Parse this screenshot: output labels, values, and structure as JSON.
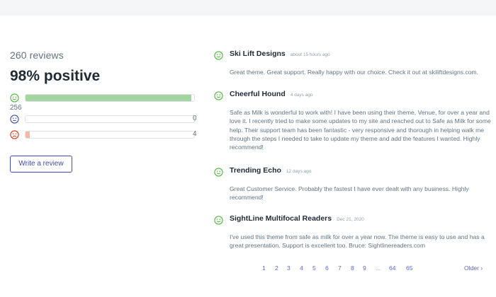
{
  "colors": {
    "positive": "#50b83c",
    "neutral": "#3f4eae",
    "negative": "#de3618",
    "positive_bar": "#a5d6a1",
    "negative_bar": "#f2b8a8",
    "link": "#5c6ac4"
  },
  "summary": {
    "reviews_count": "260 reviews",
    "positive_percent": "98% positive",
    "bars": [
      {
        "sentiment": "positive",
        "icon": "smile-icon",
        "count": "256",
        "fraction": 0.985
      },
      {
        "sentiment": "neutral",
        "icon": "neutral-face-icon",
        "count": "0",
        "fraction": 0.0
      },
      {
        "sentiment": "negative",
        "icon": "frown-icon",
        "count": "4",
        "fraction": 0.015
      }
    ],
    "write_review_label": "Write a review"
  },
  "reviews": [
    {
      "name": "Ski Lift Designs",
      "time": "about 15 hours ago",
      "body": "Great theme. Great support. Really happy with our choice. Check it out at skiliftdesigns.com.",
      "sentiment": "positive"
    },
    {
      "name": "Cheerful Hound",
      "time": "4 days ago",
      "body": "Safe as Milk is wonderful to work with! I have been using their theme, Venue, for over a year and love it. I recently tried to make some updates to my site and reached out to Safe as Milk for some help. Their support team has been fantastic - very responsive and thorough in helping walk me through the steps I needed to take to update my theme and add the features I wanted. Highly recommend!",
      "sentiment": "positive"
    },
    {
      "name": "Trending Echo",
      "time": "12 days ago",
      "body": "Great Customer Service. Probably the fastest I have ever dealt with any business. Highly recommend!",
      "sentiment": "positive"
    },
    {
      "name": "SightLine Multifocal Readers",
      "time": "Dec 21, 2020",
      "body": "I've used this theme from safe as milk for over a year now. The theme is easy to use and has a great presentation. Support is excellent too. Bruce: Sightlinereaders.com",
      "sentiment": "positive"
    }
  ],
  "pagination": {
    "pages": [
      "1",
      "2",
      "3",
      "4",
      "5",
      "6",
      "7",
      "8",
      "9"
    ],
    "ellipsis": "...",
    "last_pages": [
      "64",
      "65"
    ],
    "older_label": "Older ›"
  }
}
